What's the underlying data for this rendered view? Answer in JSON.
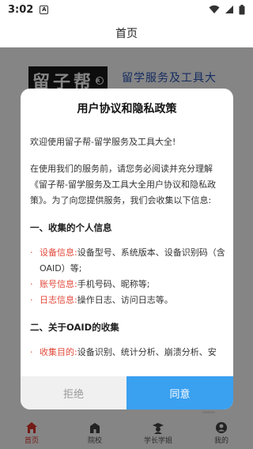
{
  "status_bar": {
    "time": "3:02",
    "notification_letter": "A"
  },
  "header": {
    "title": "首页"
  },
  "banner": {
    "logo_text": "留子帮",
    "logo_badge": "R",
    "title": "留学服务及工具大"
  },
  "dialog": {
    "title": "用户协议和隐私政策",
    "welcome": "欢迎使用留子帮-留学服务及工具大全!",
    "intro": "在使用我们的服务前，请您务必阅读并充分理解《留子帮-留学服务及工具大全用户协议和隐私政策》。为了向您提供服务，我们会收集以下信息:",
    "section1": "一、收集的个人信息",
    "section1_items": [
      {
        "key": "设备信息:",
        "value": "设备型号、系统版本、设备识别码（含OAID）等;"
      },
      {
        "key": "账号信息:",
        "value": "手机号码、昵称等;"
      },
      {
        "key": "日志信息:",
        "value": "操作日志、访问日志等。"
      }
    ],
    "section2": "二、关于OAID的收集",
    "section2_items": [
      {
        "key": "收集目的:",
        "value": "设备识别、统计分析、崩溃分析、安"
      }
    ],
    "reject_label": "拒绝",
    "agree_label": "同意"
  },
  "tabs": [
    {
      "label": "首页",
      "icon": "home-icon",
      "active": true
    },
    {
      "label": "院校",
      "icon": "school-icon",
      "active": false
    },
    {
      "label": "学长学姐",
      "icon": "graduate-icon",
      "active": false
    },
    {
      "label": "我的",
      "icon": "user-icon",
      "active": false
    }
  ],
  "colors": {
    "accent": "#3aa0f0",
    "highlight": "#e24a3b",
    "active_tab": "#e0352b"
  }
}
